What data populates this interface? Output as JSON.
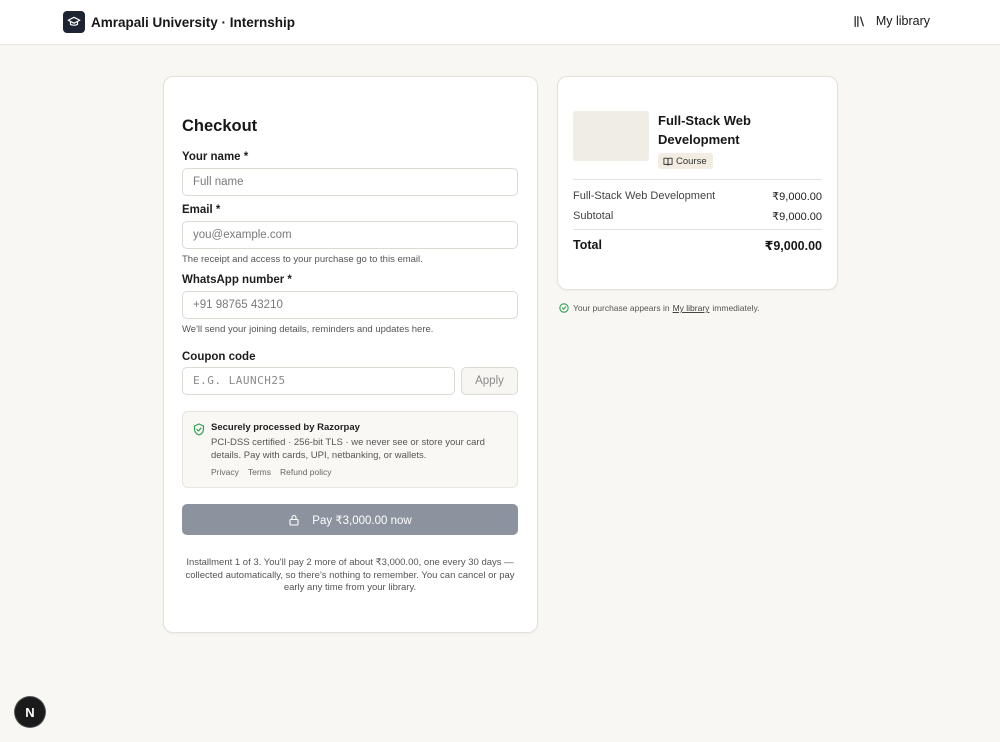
{
  "header": {
    "brand_name": "Amrapali University · Internship",
    "library_label": "My library"
  },
  "checkout": {
    "title": "Checkout",
    "name_label": "Your name *",
    "name_placeholder": "Full name",
    "email_label": "Email *",
    "email_placeholder": "you@example.com",
    "email_help": "The receipt and access to your purchase go to this email.",
    "whatsapp_label": "WhatsApp number *",
    "whatsapp_placeholder": "+91 98765 43210",
    "whatsapp_help": "We'll send your joining details, reminders and updates here.",
    "coupon_label": "Coupon code",
    "coupon_placeholder": "E.G. LAUNCH25",
    "apply_label": "Apply",
    "secure_title": "Securely processed by Razorpay",
    "secure_desc": "PCI-DSS certified · 256-bit TLS · we never see or store your card details. Pay with cards, UPI, netbanking, or wallets.",
    "links": [
      "Privacy",
      "Terms",
      "Refund policy"
    ],
    "pay_label": "Pay ₹3,000.00 now",
    "installment_note": "Installment 1 of 3. You'll pay 2 more of about ₹3,000.00, one every 30 days — collected automatically, so there's nothing to remember. You can cancel or pay early any time from your library."
  },
  "summary": {
    "product_title": "Full-Stack Web Development",
    "badge": "Course",
    "lines": [
      {
        "label": "Full-Stack Web Development",
        "amount": "₹9,000.00"
      },
      {
        "label": "Subtotal",
        "amount": "₹9,000.00"
      }
    ],
    "total_label": "Total",
    "total_amount": "₹9,000.00"
  },
  "footer_note": {
    "before": "Your purchase appears in",
    "link": "My library",
    "after": "immediately."
  },
  "dev_badge": "N",
  "colors": {
    "page_bg": "#f8f7f3",
    "pay_button": "#8c939f",
    "brand_logo": "#1e2433",
    "success_green": "#2e9e4f"
  },
  "icons": [
    "graduation-cap-icon",
    "library-icon",
    "shield-check-icon",
    "lock-icon",
    "book-icon",
    "check-circle-icon"
  ]
}
